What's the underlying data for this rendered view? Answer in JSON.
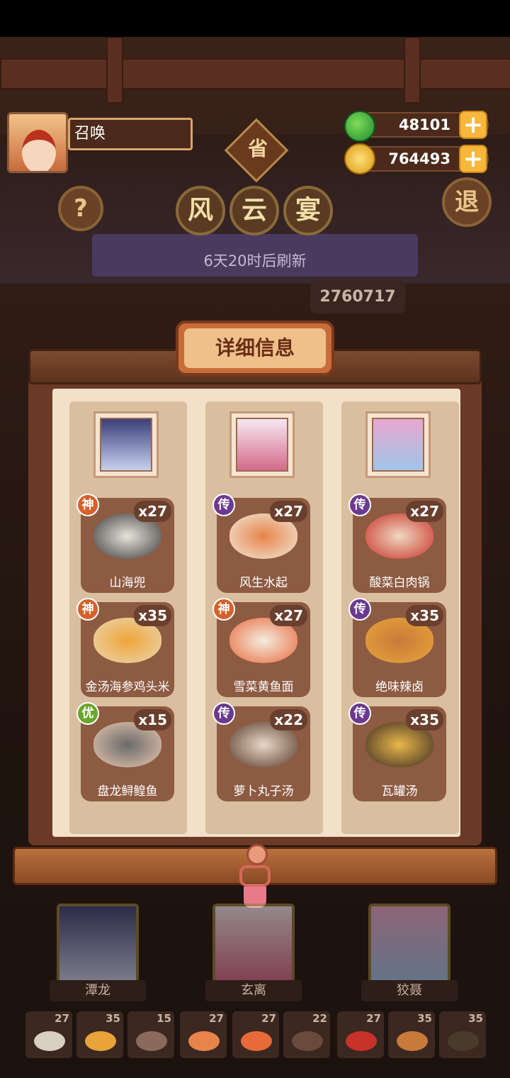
{
  "player": {
    "name": "召唤"
  },
  "currency": {
    "jade": "48101",
    "coins": "764493"
  },
  "buttons": {
    "help": "?",
    "exit": "退",
    "plus": "+"
  },
  "event": {
    "title_chars": [
      "风",
      "云",
      "宴"
    ],
    "province_mark": "省",
    "refresh_text": "6天20时后刷新",
    "score": "2760717"
  },
  "panel": {
    "title": "详细信息"
  },
  "columns": [
    {
      "dishes": [
        {
          "name": "山海兜",
          "rarity": "神",
          "qty": "x27"
        },
        {
          "name": "金汤海参鸡头米",
          "rarity": "神",
          "qty": "x35"
        },
        {
          "name": "盘龙鲟鳇鱼",
          "rarity": "优",
          "qty": "x15"
        }
      ]
    },
    {
      "dishes": [
        {
          "name": "风生水起",
          "rarity": "传",
          "qty": "x27"
        },
        {
          "name": "雪菜黄鱼面",
          "rarity": "神",
          "qty": "x27"
        },
        {
          "name": "萝卜丸子汤",
          "rarity": "传",
          "qty": "x22"
        }
      ]
    },
    {
      "dishes": [
        {
          "name": "酸菜白肉锅",
          "rarity": "传",
          "qty": "x27"
        },
        {
          "name": "绝味辣卤",
          "rarity": "传",
          "qty": "x35"
        },
        {
          "name": "瓦罐汤",
          "rarity": "传",
          "qty": "x35"
        }
      ]
    }
  ],
  "characters": [
    {
      "name": "潭龙"
    },
    {
      "name": "玄离"
    },
    {
      "name": "狡聂"
    }
  ],
  "mini_dishes": [
    "27",
    "35",
    "15",
    "27",
    "27",
    "22",
    "27",
    "35",
    "35"
  ],
  "colors": {
    "rarity_shen": "#d4622a",
    "rarity_chuan": "#6b3a8e",
    "rarity_you": "#6aa52e"
  }
}
